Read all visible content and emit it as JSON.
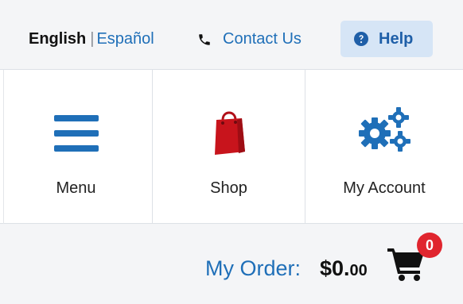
{
  "topbar": {
    "language": {
      "current": "English",
      "separator": "|",
      "alternate": "Español"
    },
    "contact": {
      "icon": "phone-icon",
      "label": "Contact Us"
    },
    "help": {
      "icon": "question-circle-icon",
      "label": "Help"
    }
  },
  "nav": {
    "tiles": [
      {
        "label": "Menu",
        "icon": "hamburger-menu-icon"
      },
      {
        "label": "Shop",
        "icon": "shopping-bag-icon"
      },
      {
        "label": "My Account",
        "icon": "gears-icon"
      }
    ]
  },
  "order": {
    "label": "My Order:",
    "amount_main": "$0.",
    "amount_cents": "00",
    "cart_icon": "shopping-cart-icon",
    "cart_count": "0"
  },
  "colors": {
    "brand_blue": "#1f6fb8",
    "help_bg": "#d6e5f6",
    "badge_red": "#e0252e",
    "bag_red": "#c8141c"
  }
}
